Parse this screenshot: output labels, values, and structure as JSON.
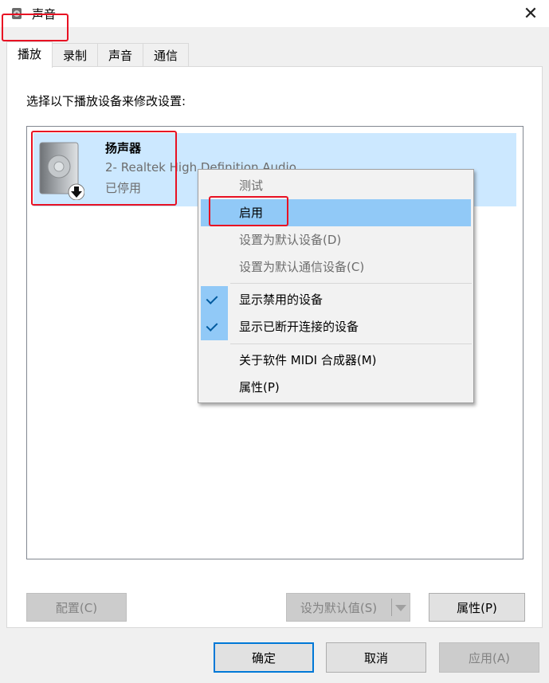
{
  "window": {
    "title": "声音",
    "close_glyph": "✕"
  },
  "tabs": [
    {
      "label": "播放",
      "active": true
    },
    {
      "label": "录制",
      "active": false
    },
    {
      "label": "声音",
      "active": false
    },
    {
      "label": "通信",
      "active": false
    }
  ],
  "panel": {
    "instruction": "选择以下播放设备来修改设置:"
  },
  "device": {
    "name": "扬声器",
    "description": "2- Realtek High Definition Audio",
    "status": "已停用",
    "icon": "speaker-icon",
    "badge_icon": "disabled-arrow-icon"
  },
  "context_menu": {
    "items": [
      {
        "label": "测试",
        "enabled": false
      },
      {
        "label": "启用",
        "enabled": true,
        "highlighted": true
      },
      {
        "label": "设置为默认设备(D)",
        "enabled": false
      },
      {
        "label": "设置为默认通信设备(C)",
        "enabled": false
      },
      {
        "label": "显示禁用的设备",
        "enabled": true,
        "checked": true
      },
      {
        "label": "显示已断开连接的设备",
        "enabled": true,
        "checked": true
      },
      {
        "label": "关于软件 MIDI 合成器(M)",
        "enabled": true
      },
      {
        "label": "属性(P)",
        "enabled": true
      }
    ]
  },
  "panel_buttons": {
    "configure": "配置(C)",
    "set_default": "设为默认值(S)",
    "properties": "属性(P)"
  },
  "footer": {
    "ok": "确定",
    "cancel": "取消",
    "apply": "应用(A)"
  },
  "colors": {
    "selection": "#cce8ff",
    "menu_hover": "#91c9f7",
    "highlight_box": "#e81123",
    "focus": "#0078d7"
  }
}
